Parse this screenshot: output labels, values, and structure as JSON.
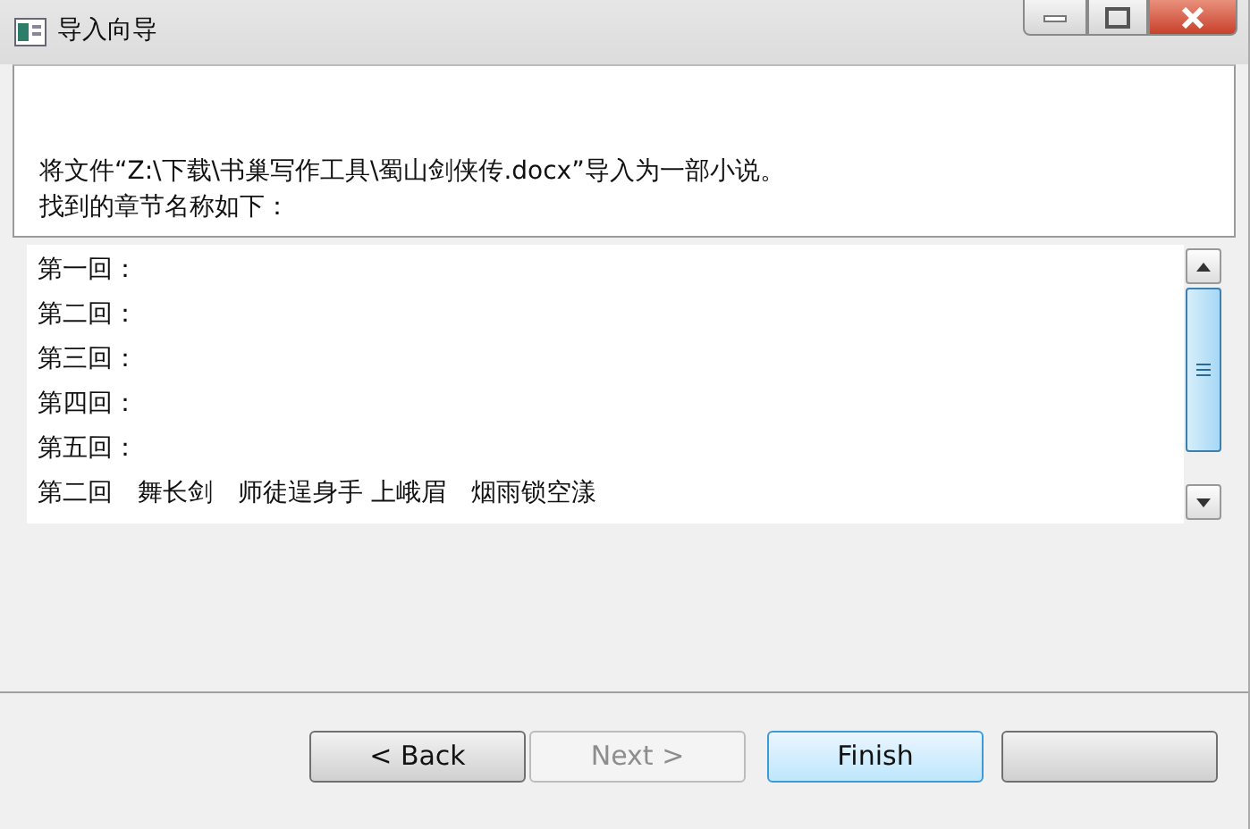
{
  "window": {
    "title": "导入向导"
  },
  "intro": [
    "将文件“Z:\\下载\\书巢写作工具\\蜀山剑侠传.docx”导入为一部小说。",
    "找到的章节名称如下："
  ],
  "chapters": [
    "第一回：",
    "第二回：",
    "第三回：",
    "第四回：",
    "第五回：",
    "第二回　舞长剑　师徒逞身手 上峨眉　烟雨锁空漾"
  ],
  "buttons": [
    {
      "label": "< Back",
      "disabled": false,
      "default": false
    },
    {
      "label": "Next >",
      "disabled": true,
      "default": false
    },
    {
      "label": "Finish",
      "disabled": false,
      "default": true
    },
    {
      "disabled": false,
      "default": false
    }
  ]
}
